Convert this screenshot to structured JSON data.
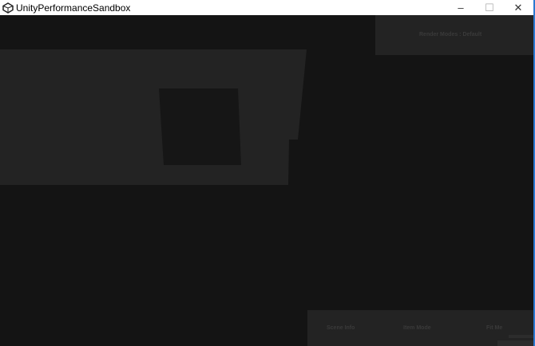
{
  "window": {
    "title": "UnityPerformanceSandbox",
    "minimize": "–",
    "maximize": "☐",
    "close": "✕"
  },
  "hud": {
    "top_right_label": "Render Modes : Default",
    "bottom_buttons": [
      "Scene Info",
      "Item Mode",
      "Fit Me"
    ]
  }
}
